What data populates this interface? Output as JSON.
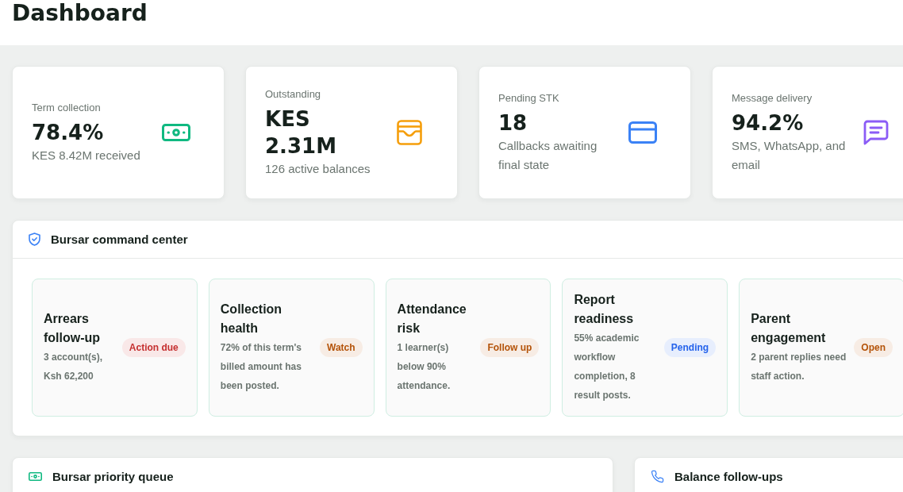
{
  "page": {
    "title": "Dashboard"
  },
  "stats": [
    {
      "label": "Term collection",
      "value": "78.4%",
      "detail": "KES 8.42M received"
    },
    {
      "label": "Outstanding",
      "value": "KES 2.31M",
      "detail": "126 active balances"
    },
    {
      "label": "Pending STK",
      "value": "18",
      "detail": "Callbacks awaiting final state"
    },
    {
      "label": "Message delivery",
      "value": "94.2%",
      "detail": "SMS, WhatsApp, and email"
    }
  ],
  "command_center": {
    "title": "Bursar command center",
    "cards": [
      {
        "title": "Arrears follow-up",
        "detail": "3 account(s), Ksh 62,200",
        "badge": "Action due",
        "color": "#c53030"
      },
      {
        "title": "Collection health",
        "detail": "72% of this term's billed amount has been posted.",
        "badge": "Watch",
        "color": "#b45309"
      },
      {
        "title": "Attendance risk",
        "detail": "1 learner(s) below 90% attendance.",
        "badge": "Follow up",
        "color": "#b45309"
      },
      {
        "title": "Report readiness",
        "detail": "55% academic workflow completion, 8 result posts.",
        "badge": "Pending",
        "color": "#2563eb"
      },
      {
        "title": "Parent engagement",
        "detail": "2 parent replies need staff action.",
        "badge": "Open",
        "color": "#b45309"
      }
    ]
  },
  "panels": [
    {
      "title": "Bursar priority queue"
    },
    {
      "title": "Balance follow-ups"
    }
  ]
}
